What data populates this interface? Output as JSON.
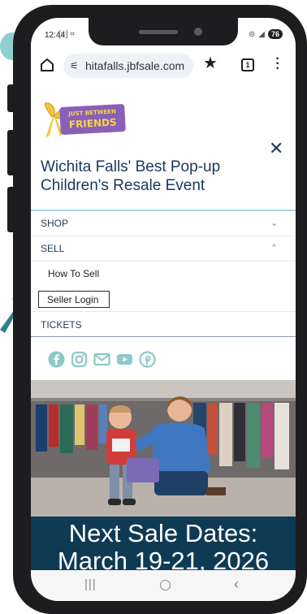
{
  "status_bar": {
    "time": "12:44",
    "battery": "76"
  },
  "browser": {
    "url": "hitafalls.jbfsale.com",
    "tab_count": "1"
  },
  "logo": {
    "line1": "JUST BETWEEN",
    "line2": "FRIENDS"
  },
  "hero": {
    "title": "Wichita Falls' Best Pop-up Children's Resale Event"
  },
  "nav": {
    "shop": "SHOP",
    "sell": "SELL",
    "how_to_sell": "How To Sell",
    "seller_login": "Seller Login",
    "tickets": "TICKETS"
  },
  "social": [
    "facebook-icon",
    "instagram-icon",
    "email-icon",
    "youtube-icon",
    "pinterest-icon"
  ],
  "sale_banner": {
    "line1": "Next Sale Dates:",
    "line2": "March 19-21, 2026"
  },
  "colors": {
    "navy": "#17385c",
    "teal_social": "#8cc9c8",
    "banner": "#0f3a54"
  }
}
